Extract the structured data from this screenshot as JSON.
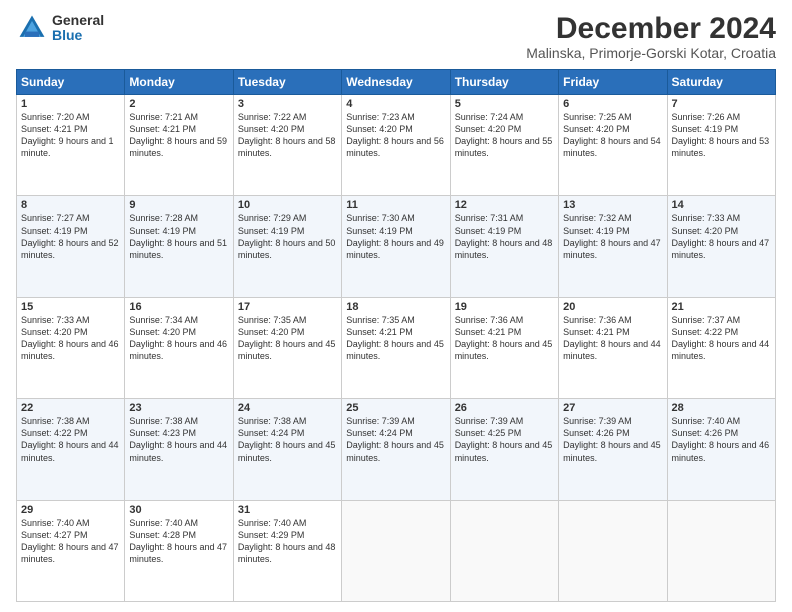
{
  "logo": {
    "general": "General",
    "blue": "Blue"
  },
  "title": "December 2024",
  "subtitle": "Malinska, Primorje-Gorski Kotar, Croatia",
  "days_header": [
    "Sunday",
    "Monday",
    "Tuesday",
    "Wednesday",
    "Thursday",
    "Friday",
    "Saturday"
  ],
  "weeks": [
    [
      {
        "day": "1",
        "sunrise": "7:20 AM",
        "sunset": "4:21 PM",
        "daylight": "9 hours and 1 minute."
      },
      {
        "day": "2",
        "sunrise": "7:21 AM",
        "sunset": "4:21 PM",
        "daylight": "8 hours and 59 minutes."
      },
      {
        "day": "3",
        "sunrise": "7:22 AM",
        "sunset": "4:20 PM",
        "daylight": "8 hours and 58 minutes."
      },
      {
        "day": "4",
        "sunrise": "7:23 AM",
        "sunset": "4:20 PM",
        "daylight": "8 hours and 56 minutes."
      },
      {
        "day": "5",
        "sunrise": "7:24 AM",
        "sunset": "4:20 PM",
        "daylight": "8 hours and 55 minutes."
      },
      {
        "day": "6",
        "sunrise": "7:25 AM",
        "sunset": "4:20 PM",
        "daylight": "8 hours and 54 minutes."
      },
      {
        "day": "7",
        "sunrise": "7:26 AM",
        "sunset": "4:19 PM",
        "daylight": "8 hours and 53 minutes."
      }
    ],
    [
      {
        "day": "8",
        "sunrise": "7:27 AM",
        "sunset": "4:19 PM",
        "daylight": "8 hours and 52 minutes."
      },
      {
        "day": "9",
        "sunrise": "7:28 AM",
        "sunset": "4:19 PM",
        "daylight": "8 hours and 51 minutes."
      },
      {
        "day": "10",
        "sunrise": "7:29 AM",
        "sunset": "4:19 PM",
        "daylight": "8 hours and 50 minutes."
      },
      {
        "day": "11",
        "sunrise": "7:30 AM",
        "sunset": "4:19 PM",
        "daylight": "8 hours and 49 minutes."
      },
      {
        "day": "12",
        "sunrise": "7:31 AM",
        "sunset": "4:19 PM",
        "daylight": "8 hours and 48 minutes."
      },
      {
        "day": "13",
        "sunrise": "7:32 AM",
        "sunset": "4:19 PM",
        "daylight": "8 hours and 47 minutes."
      },
      {
        "day": "14",
        "sunrise": "7:33 AM",
        "sunset": "4:20 PM",
        "daylight": "8 hours and 47 minutes."
      }
    ],
    [
      {
        "day": "15",
        "sunrise": "7:33 AM",
        "sunset": "4:20 PM",
        "daylight": "8 hours and 46 minutes."
      },
      {
        "day": "16",
        "sunrise": "7:34 AM",
        "sunset": "4:20 PM",
        "daylight": "8 hours and 46 minutes."
      },
      {
        "day": "17",
        "sunrise": "7:35 AM",
        "sunset": "4:20 PM",
        "daylight": "8 hours and 45 minutes."
      },
      {
        "day": "18",
        "sunrise": "7:35 AM",
        "sunset": "4:21 PM",
        "daylight": "8 hours and 45 minutes."
      },
      {
        "day": "19",
        "sunrise": "7:36 AM",
        "sunset": "4:21 PM",
        "daylight": "8 hours and 45 minutes."
      },
      {
        "day": "20",
        "sunrise": "7:36 AM",
        "sunset": "4:21 PM",
        "daylight": "8 hours and 44 minutes."
      },
      {
        "day": "21",
        "sunrise": "7:37 AM",
        "sunset": "4:22 PM",
        "daylight": "8 hours and 44 minutes."
      }
    ],
    [
      {
        "day": "22",
        "sunrise": "7:38 AM",
        "sunset": "4:22 PM",
        "daylight": "8 hours and 44 minutes."
      },
      {
        "day": "23",
        "sunrise": "7:38 AM",
        "sunset": "4:23 PM",
        "daylight": "8 hours and 44 minutes."
      },
      {
        "day": "24",
        "sunrise": "7:38 AM",
        "sunset": "4:24 PM",
        "daylight": "8 hours and 45 minutes."
      },
      {
        "day": "25",
        "sunrise": "7:39 AM",
        "sunset": "4:24 PM",
        "daylight": "8 hours and 45 minutes."
      },
      {
        "day": "26",
        "sunrise": "7:39 AM",
        "sunset": "4:25 PM",
        "daylight": "8 hours and 45 minutes."
      },
      {
        "day": "27",
        "sunrise": "7:39 AM",
        "sunset": "4:26 PM",
        "daylight": "8 hours and 45 minutes."
      },
      {
        "day": "28",
        "sunrise": "7:40 AM",
        "sunset": "4:26 PM",
        "daylight": "8 hours and 46 minutes."
      }
    ],
    [
      {
        "day": "29",
        "sunrise": "7:40 AM",
        "sunset": "4:27 PM",
        "daylight": "8 hours and 47 minutes."
      },
      {
        "day": "30",
        "sunrise": "7:40 AM",
        "sunset": "4:28 PM",
        "daylight": "8 hours and 47 minutes."
      },
      {
        "day": "31",
        "sunrise": "7:40 AM",
        "sunset": "4:29 PM",
        "daylight": "8 hours and 48 minutes."
      },
      null,
      null,
      null,
      null
    ]
  ],
  "labels": {
    "sunrise": "Sunrise:",
    "sunset": "Sunset:",
    "daylight": "Daylight:"
  }
}
